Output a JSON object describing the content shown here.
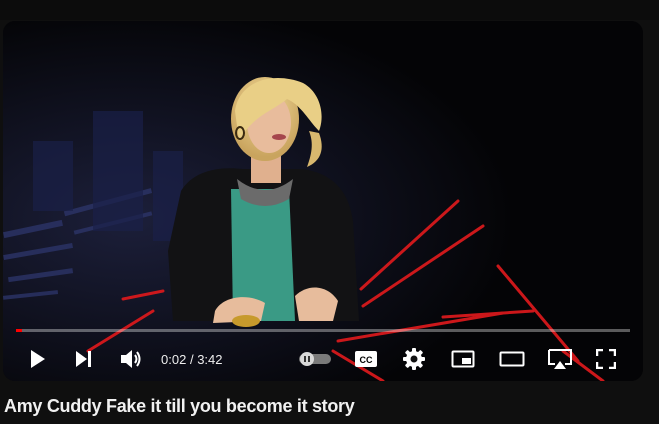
{
  "video": {
    "title": "Amy Cuddy Fake it till you become it story",
    "progress": 0.009
  },
  "player": {
    "current_time": "0:02",
    "separator": "/",
    "duration": "3:42",
    "captions_label": "CC"
  },
  "controls": {
    "icons": [
      "play-icon",
      "next-icon",
      "volume-icon",
      "autoplay-toggle",
      "subtitles-icon",
      "settings-gear-icon",
      "miniplayer-icon",
      "theater-mode-icon",
      "cast-icon",
      "fullscreen-icon"
    ]
  },
  "colors": {
    "progress": "#ff0000",
    "background": "#0f0f0f",
    "accent_lines": "#d7191c",
    "sweater": "#3a9a85"
  }
}
